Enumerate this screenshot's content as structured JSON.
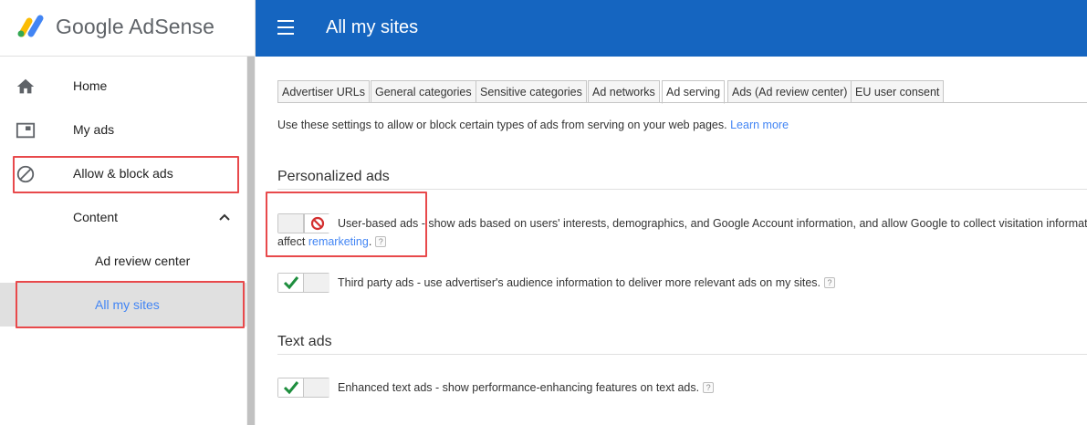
{
  "brand": {
    "name": "Google AdSense"
  },
  "sidebar": {
    "items": [
      {
        "label": "Home",
        "icon": "home-icon"
      },
      {
        "label": "My ads",
        "icon": "ad-unit-icon"
      },
      {
        "label": "Allow & block ads",
        "icon": "block-icon"
      },
      {
        "label": "Content",
        "icon": "chevron-up-icon"
      },
      {
        "label": "Ad review center"
      },
      {
        "label": "All my sites"
      }
    ]
  },
  "header": {
    "title": "All my sites",
    "menu_icon": "menu-icon"
  },
  "tabs": [
    {
      "label": "Advertiser URLs"
    },
    {
      "label": "General categories"
    },
    {
      "label": "Sensitive categories"
    },
    {
      "label": "Ad networks"
    },
    {
      "label": "Ad serving"
    },
    {
      "label": "Ads (Ad review center)"
    },
    {
      "label": "EU user consent"
    }
  ],
  "intro": {
    "text": "Use these settings to allow or block certain types of ads from serving on your web pages.",
    "link": "Learn more"
  },
  "personalized": {
    "title": "Personalized ads",
    "user_based": {
      "name": "User-based ads",
      "desc": " - show ads based on users' interests, demographics, and Google Account information, and allow Google to collect visitation information",
      "line2_prefix": "affect ",
      "line2_link": "remarketing",
      "line2_suffix": ".",
      "state": "blocked"
    },
    "third_party": {
      "text": "Third party ads - use advertiser's audience information to deliver more relevant ads on my sites.",
      "state": "allowed"
    }
  },
  "text_ads": {
    "title": "Text ads",
    "enhanced": {
      "text": "Enhanced text ads - show performance-enhancing features on text ads.",
      "state": "allowed"
    }
  },
  "help_glyph": "?",
  "colors": {
    "header": "#1565c0",
    "link": "#4285f4",
    "highlight": "#e8494b",
    "check": "#1e8e3e",
    "block": "#d32f2f"
  }
}
